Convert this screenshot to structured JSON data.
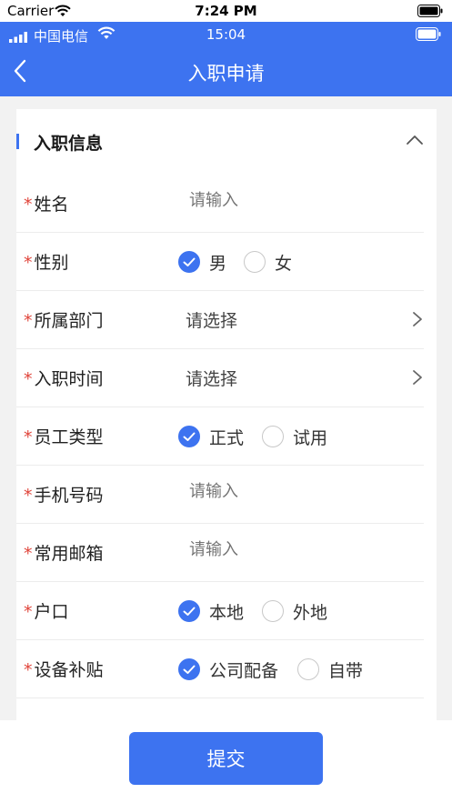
{
  "sim_status": {
    "carrier": "Carrier",
    "time": "7:24 PM"
  },
  "app_status": {
    "carrier": "中国电信",
    "time": "15:04"
  },
  "nav": {
    "title": "入职申请"
  },
  "section": {
    "title": "入职信息"
  },
  "required_mark": "*",
  "fields": {
    "name": {
      "label": "姓名",
      "placeholder": "请输入"
    },
    "gender": {
      "label": "性别",
      "options": [
        "男",
        "女"
      ],
      "selected": "男"
    },
    "department": {
      "label": "所属部门",
      "value": "请选择"
    },
    "entry_time": {
      "label": "入职时间",
      "value": "请选择"
    },
    "employee_type": {
      "label": "员工类型",
      "options": [
        "正式",
        "试用"
      ],
      "selected": "正式"
    },
    "phone": {
      "label": "手机号码",
      "placeholder": "请输入"
    },
    "email": {
      "label": "常用邮箱",
      "placeholder": "请输入"
    },
    "household": {
      "label": "户口",
      "options": [
        "本地",
        "外地"
      ],
      "selected": "本地"
    },
    "device_subsidy": {
      "label": "设备补贴",
      "options": [
        "公司配备",
        "自带"
      ],
      "selected": "公司配备"
    }
  },
  "submit_label": "提交",
  "colors": {
    "primary": "#3d73f0",
    "required": "#e0443a",
    "placeholder": "#b3b3b3"
  },
  "icons": [
    "wifi-icon",
    "battery-icon",
    "signal-icon",
    "back-arrow-icon",
    "chevron-up-icon",
    "chevron-right-icon",
    "check-icon"
  ]
}
